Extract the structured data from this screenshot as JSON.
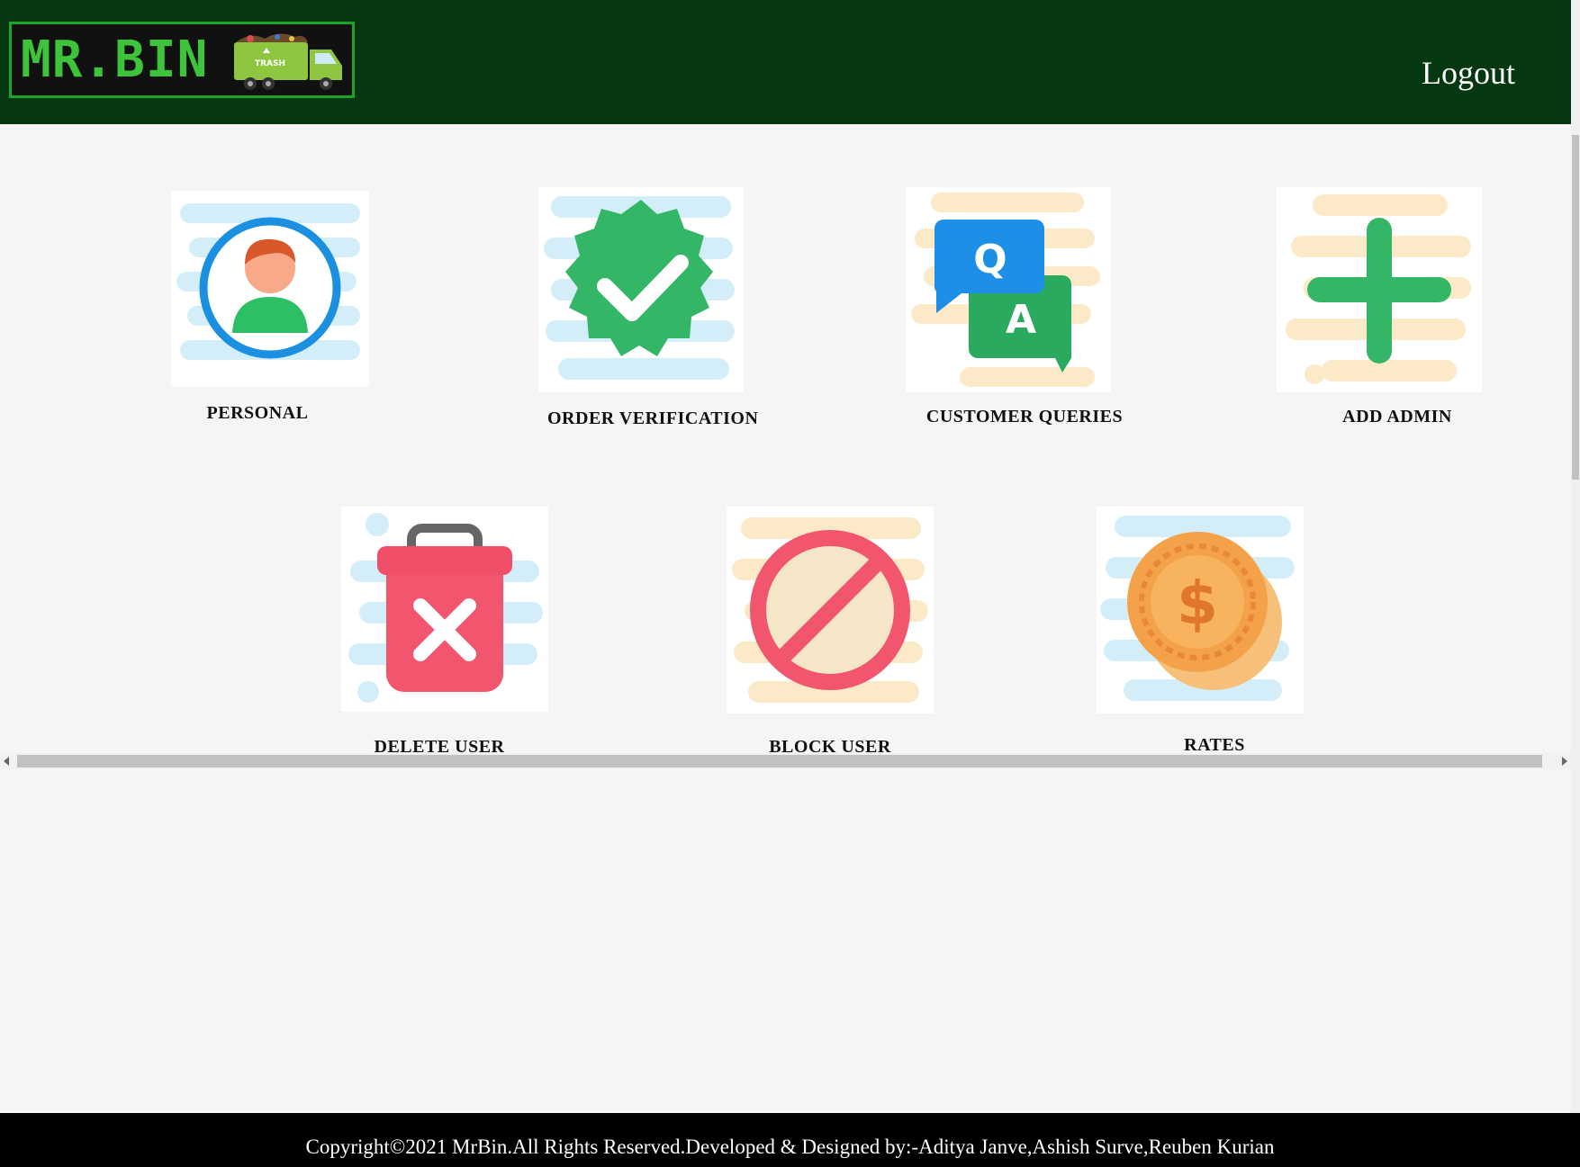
{
  "header": {
    "logo_text": "MR.BIN",
    "logo_truck_text": "TRASH",
    "logout_label": "Logout"
  },
  "tiles": [
    {
      "label": "PERSONAL",
      "icon": "user-avatar-icon"
    },
    {
      "label": "ORDER VERIFICATION",
      "icon": "verified-check-icon"
    },
    {
      "label": "CUSTOMER QUERIES",
      "icon": "qa-chat-icon"
    },
    {
      "label": "ADD ADMIN",
      "icon": "plus-icon"
    },
    {
      "label": "DELETE USER",
      "icon": "trash-delete-icon"
    },
    {
      "label": "BLOCK USER",
      "icon": "block-icon"
    },
    {
      "label": "RATES",
      "icon": "coins-icon"
    }
  ],
  "qa": {
    "q": "Q",
    "a": "A"
  },
  "rates_symbol": "$",
  "footer": {
    "text": "Copyright©2021 MrBin.All Rights Reserved.Developed & Designed by:-Aditya Janve,Ashish Surve,Reuben Kurian"
  },
  "colors": {
    "header_bg": "#053810",
    "logo_green": "#3ec43a",
    "footer_bg": "#000000",
    "page_bg": "#f5f5f5"
  }
}
